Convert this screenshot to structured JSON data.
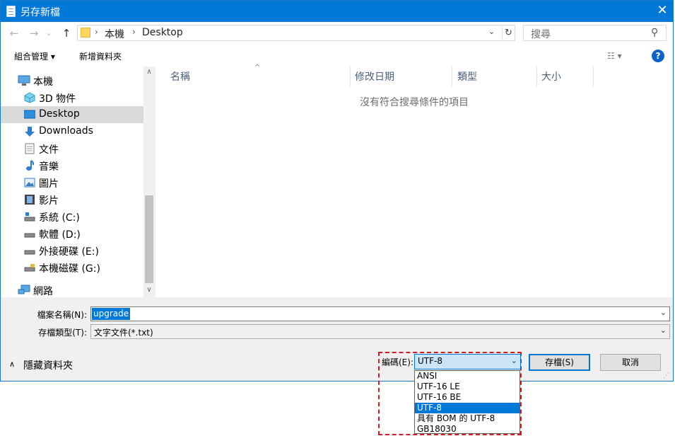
{
  "window": {
    "title": "另存新檔",
    "close_glyph": "✕"
  },
  "nav": {
    "back_glyph": "←",
    "forward_glyph": "→",
    "recent_glyph": "⌄",
    "up_glyph": "↑",
    "breadcrumbs": [
      "本機",
      "Desktop"
    ],
    "crumb_sep": "›",
    "search_placeholder": "搜尋",
    "dropdown_glyph": "⌄",
    "refresh_glyph": "↻",
    "search_glyph": "⚲"
  },
  "toolbar": {
    "organize_label": "組合管理 ▾",
    "new_folder_label": "新增資料夾",
    "view_glyph": "☷ ▾",
    "help_glyph": "?"
  },
  "sidebar": {
    "items": [
      {
        "label": "本機",
        "icon": "computer-icon"
      },
      {
        "label": "3D 物件",
        "icon": "cube-icon"
      },
      {
        "label": "Desktop",
        "icon": "desktop-icon",
        "selected": true
      },
      {
        "label": "Downloads",
        "icon": "download-arrow-icon"
      },
      {
        "label": "文件",
        "icon": "document-icon"
      },
      {
        "label": "音樂",
        "icon": "music-note-icon"
      },
      {
        "label": "圖片",
        "icon": "picture-icon"
      },
      {
        "label": "影片",
        "icon": "film-icon"
      },
      {
        "label": "系統 (C:)",
        "icon": "system-drive-icon"
      },
      {
        "label": "軟體 (D:)",
        "icon": "drive-icon"
      },
      {
        "label": "外接硬碟 (E:)",
        "icon": "drive-icon"
      },
      {
        "label": "本機磁碟 (G:)",
        "icon": "locked-drive-icon"
      },
      {
        "label": "網路",
        "icon": "network-icon"
      }
    ],
    "scroll_up_glyph": "∧",
    "scroll_down_glyph": "∨"
  },
  "filelist": {
    "columns": [
      "名稱",
      "修改日期",
      "類型",
      "大小"
    ],
    "sort_glyph": "^",
    "empty_message": "沒有符合搜尋條件的項目"
  },
  "form": {
    "filename_label": "檔案名稱(N):",
    "filename_value": "upgrade",
    "filetype_label": "存檔類型(T):",
    "filetype_value": "文字文件(*.txt)",
    "combo_glyph": "⌄",
    "hide_folders_label": "隱藏資料夾",
    "hide_chev_glyph": "∧",
    "encoding_label": "編碼(E):",
    "encoding_value": "UTF-8",
    "encoding_options": [
      "ANSI",
      "UTF-16 LE",
      "UTF-16 BE",
      "UTF-8",
      "具有 BOM 的 UTF-8",
      "GB18030"
    ],
    "encoding_selected_index": 3,
    "save_label": "存檔(S)",
    "cancel_label": "取消"
  },
  "colors": {
    "accent": "#0078d7",
    "highlight_outline": "#d71920"
  }
}
